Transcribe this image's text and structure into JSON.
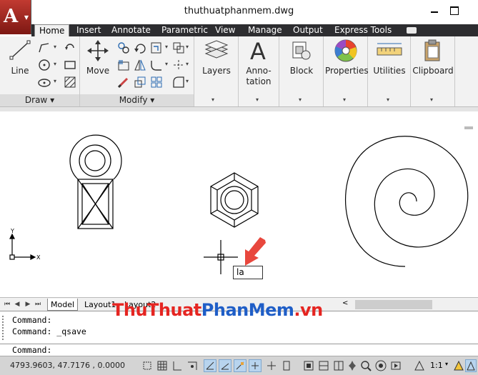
{
  "window": {
    "title": "thuthuatphanmem.dwg",
    "app_button_letter": "A"
  },
  "tabs": [
    "Home",
    "Insert",
    "Annotate",
    "Parametric",
    "View",
    "Manage",
    "Output",
    "Express Tools"
  ],
  "ribbon": {
    "draw": {
      "line_label": "Line",
      "panel_label": "Draw"
    },
    "modify": {
      "move_label": "Move",
      "panel_label": "Modify"
    },
    "layers_label": "Layers",
    "annotation": {
      "label_line1": "Anno-",
      "label_line2": "tation"
    },
    "block_label": "Block",
    "properties_label": "Properties",
    "utilities_label": "Utilities",
    "clipboard_label": "Clipboard"
  },
  "canvas": {
    "ucs_x_label": "X",
    "ucs_y_label": "Y",
    "dynamic_input_value": "la"
  },
  "layout_tabs": [
    "Model",
    "Layout1",
    "Layout2"
  ],
  "command": {
    "history": [
      "Command:",
      "Command:  _qsave"
    ],
    "prompt": "Command:"
  },
  "watermark": {
    "part1": "ThuThuat",
    "part2": "PhanMem",
    "part3": ".vn"
  },
  "status": {
    "coordinates": "4793.9603, 47.7176 , 0.0000",
    "annotation_scale": "1:1"
  },
  "colors": {
    "app_button": "#a82a22",
    "tab_bar": "#2d2d30",
    "annotation_arrow": "#e8473d",
    "watermark_red": "#e52521",
    "watermark_blue": "#1f5ec7"
  }
}
